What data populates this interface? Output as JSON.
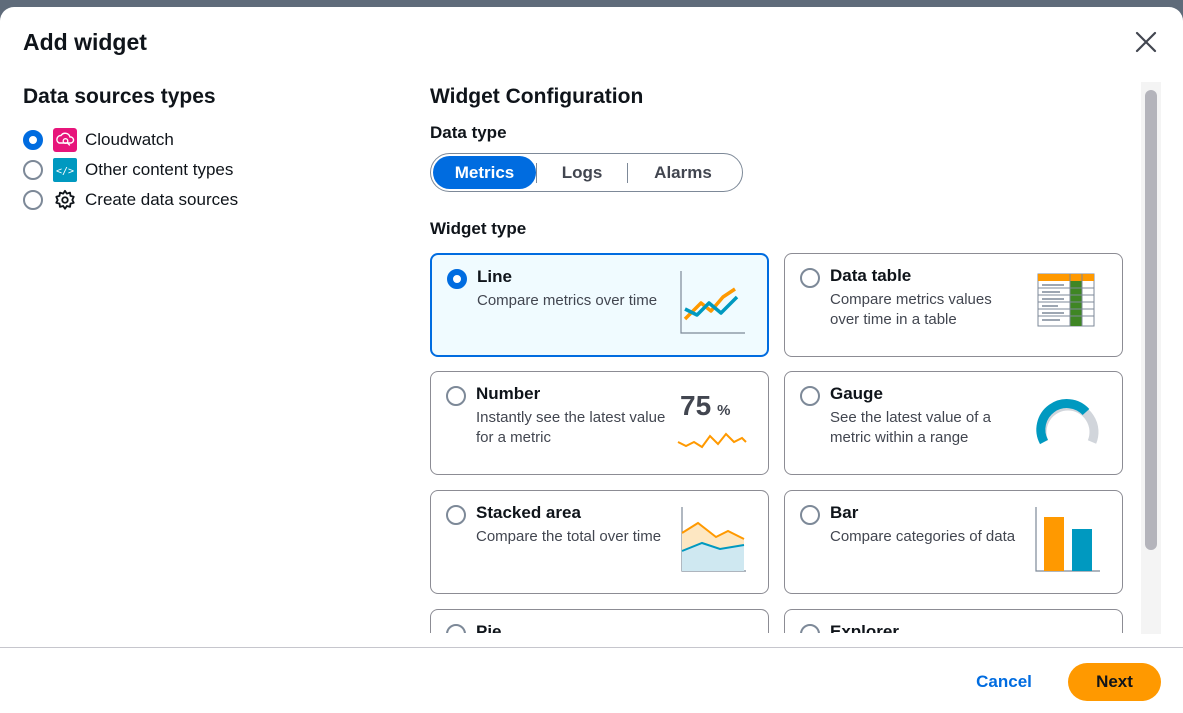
{
  "modal": {
    "title": "Add widget"
  },
  "data_sources": {
    "title": "Data sources types",
    "options": [
      {
        "label": "Cloudwatch",
        "icon": "cloudwatch-icon",
        "checked": true
      },
      {
        "label": "Other content types",
        "icon": "code-icon",
        "checked": false
      },
      {
        "label": "Create data sources",
        "icon": "gear-icon",
        "checked": false
      }
    ]
  },
  "config": {
    "title": "Widget Configuration",
    "data_type_label": "Data type",
    "data_types": [
      "Metrics",
      "Logs",
      "Alarms"
    ],
    "selected_data_type": "Metrics",
    "widget_type_label": "Widget type",
    "widgets": [
      {
        "title": "Line",
        "desc": "Compare metrics over time",
        "selected": true
      },
      {
        "title": "Data table",
        "desc": "Compare metrics values over time in a table",
        "selected": false
      },
      {
        "title": "Number",
        "desc": "Instantly see the latest value for a metric",
        "selected": false,
        "art_value": "75",
        "art_unit": "%"
      },
      {
        "title": "Gauge",
        "desc": "See the latest value of a metric within a range",
        "selected": false
      },
      {
        "title": "Stacked area",
        "desc": "Compare the total over time",
        "selected": false
      },
      {
        "title": "Bar",
        "desc": "Compare categories of data",
        "selected": false
      },
      {
        "title": "Pie",
        "desc": "",
        "selected": false
      },
      {
        "title": "Explorer",
        "desc": "",
        "selected": false
      }
    ]
  },
  "footer": {
    "cancel": "Cancel",
    "next": "Next"
  },
  "colors": {
    "primary": "#006ce0",
    "accent": "#ff9900",
    "teal": "#0099c0"
  }
}
